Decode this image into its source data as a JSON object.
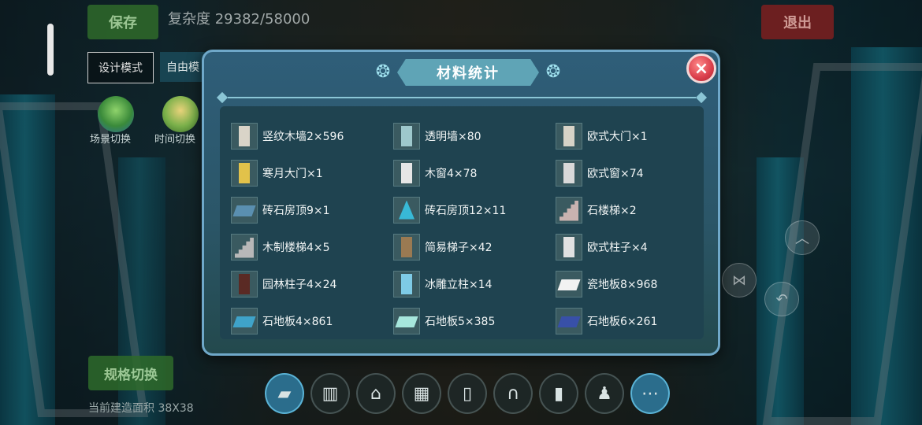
{
  "hud": {
    "save_label": "保存",
    "complexity": "复杂度 29382/58000",
    "exit_label": "退出",
    "mode_design": "设计模式",
    "mode_free": "自由模",
    "scene_switch": "场景切换",
    "time_switch": "时间切换",
    "spec_switch": "规格切换",
    "build_area": "当前建造面积 38X38"
  },
  "dialog": {
    "title": "材料统计",
    "close_label": "×",
    "items": [
      {
        "name": "竖纹木墙2×596",
        "icon": "wood-wall-icon",
        "color": "#d9d4c8"
      },
      {
        "name": "透明墙×80",
        "icon": "glass-wall-icon",
        "color": "#9ec8cc"
      },
      {
        "name": "欧式大门×1",
        "icon": "european-gate-icon",
        "color": "#d7d3c7"
      },
      {
        "name": "寒月大门×1",
        "icon": "moon-gate-icon",
        "color": "#e2c24a"
      },
      {
        "name": "木窗4×78",
        "icon": "wood-window-icon",
        "color": "#e6e6e6"
      },
      {
        "name": "欧式窗×74",
        "icon": "european-window-icon",
        "color": "#d9d9d9"
      },
      {
        "name": "砖石房顶9×1",
        "icon": "brick-roof-icon",
        "color": "#5a8fb0"
      },
      {
        "name": "砖石房顶12×11",
        "icon": "cone-roof-icon",
        "color": "#38b9d6"
      },
      {
        "name": "石楼梯×2",
        "icon": "stone-stairs-icon",
        "color": "#c9b3b0"
      },
      {
        "name": "木制楼梯4×5",
        "icon": "wood-stairs-icon",
        "color": "#b8b8b8"
      },
      {
        "name": "简易梯子×42",
        "icon": "ladder-icon",
        "color": "#9a7a52"
      },
      {
        "name": "欧式柱子×4",
        "icon": "european-pillar-icon",
        "color": "#e1e1e1"
      },
      {
        "name": "园林柱子4×24",
        "icon": "garden-pillar-icon",
        "color": "#5a2a24"
      },
      {
        "name": "冰雕立柱×14",
        "icon": "ice-pillar-icon",
        "color": "#7ecbe6"
      },
      {
        "name": "瓷地板8×968",
        "icon": "porcelain-floor-icon",
        "color": "#f2f2f2"
      },
      {
        "name": "石地板4×861",
        "icon": "stone-floor-icon",
        "color": "#3fa3c9"
      },
      {
        "name": "石地板5×385",
        "icon": "stone-floor-light-icon",
        "color": "#a6e6dc"
      },
      {
        "name": "石地板6×261",
        "icon": "stone-floor-dark-icon",
        "color": "#3850a8"
      }
    ]
  },
  "hotbar": [
    {
      "icon": "eraser-icon",
      "glyph": "▰"
    },
    {
      "icon": "fence-icon",
      "glyph": "▥"
    },
    {
      "icon": "arch-gate-icon",
      "glyph": "⌂"
    },
    {
      "icon": "window-icon",
      "glyph": "▦"
    },
    {
      "icon": "door-icon",
      "glyph": "▯"
    },
    {
      "icon": "arch-icon",
      "glyph": "∩"
    },
    {
      "icon": "panel-door-icon",
      "glyph": "▮"
    },
    {
      "icon": "lamp-post-icon",
      "glyph": "♟"
    },
    {
      "icon": "more-icon",
      "glyph": "⋯"
    }
  ]
}
